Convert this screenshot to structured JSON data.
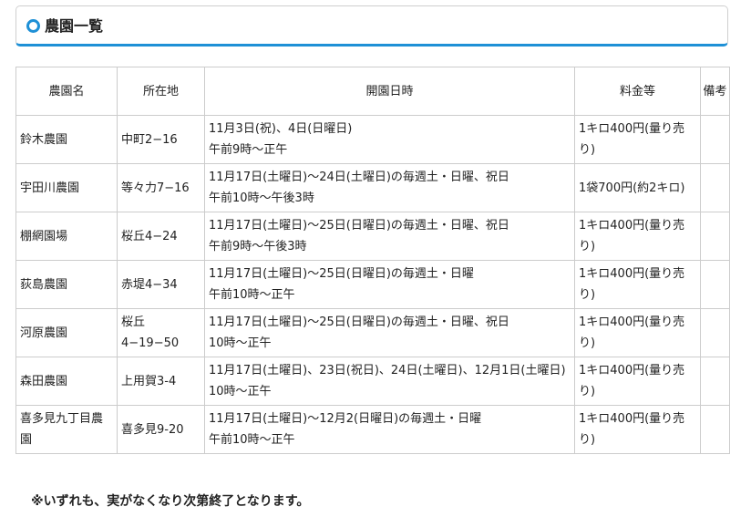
{
  "section": {
    "title": "農園一覧"
  },
  "table": {
    "headers": {
      "name": "農園名",
      "location": "所在地",
      "dates": "開園日時",
      "fee": "料金等",
      "remarks": "備考"
    },
    "rows": [
      {
        "name": "鈴木農園",
        "location": "中町2−16",
        "dates": "11月3日(祝)、4日(日曜日)",
        "hours": "午前9時〜正午",
        "fee": "1キロ400円(量り売り)",
        "remarks": ""
      },
      {
        "name": "宇田川農園",
        "location": "等々力7−16",
        "dates": "11月17日(土曜日)〜24日(土曜日)の毎週土・日曜、祝日",
        "hours": "午前10時〜午後3時",
        "fee": "1袋700円(約2キロ)",
        "remarks": ""
      },
      {
        "name": "棚網園場",
        "location": "桜丘4−24",
        "dates": "11月17日(土曜日)〜25日(日曜日)の毎週土・日曜、祝日",
        "hours": "午前9時〜午後3時",
        "fee": "1キロ400円(量り売り)",
        "remarks": ""
      },
      {
        "name": "荻島農園",
        "location": "赤堤4−34",
        "dates": "11月17日(土曜日)〜25日(日曜日)の毎週土・日曜",
        "hours": "午前10時〜正午",
        "fee": "1キロ400円(量り売り)",
        "remarks": ""
      },
      {
        "name": "河原農園",
        "location": "桜丘4−19−50",
        "dates": "11月17日(土曜日)〜25日(日曜日)の毎週土・日曜、祝日",
        "hours": "10時〜正午",
        "fee": "1キロ400円(量り売り)",
        "remarks": ""
      },
      {
        "name": "森田農園",
        "location": "上用賀3-4",
        "dates": "11月17日(土曜日)、23日(祝日)、24日(土曜日)、12月1日(土曜日)",
        "hours": "10時〜正午",
        "fee": "1キロ400円(量り売り)",
        "remarks": ""
      },
      {
        "name": "喜多見九丁目農園",
        "location": "喜多見9-20",
        "dates": "11月17日(土曜日)〜12月2(日曜日)の毎週土・日曜",
        "hours": "午前10時〜正午",
        "fee": "1キロ400円(量り売り)",
        "remarks": ""
      }
    ]
  },
  "note": "※いずれも、実がなくなり次第終了となります。",
  "colors": {
    "accent": "#1e90d6",
    "border": "#cccccc"
  }
}
